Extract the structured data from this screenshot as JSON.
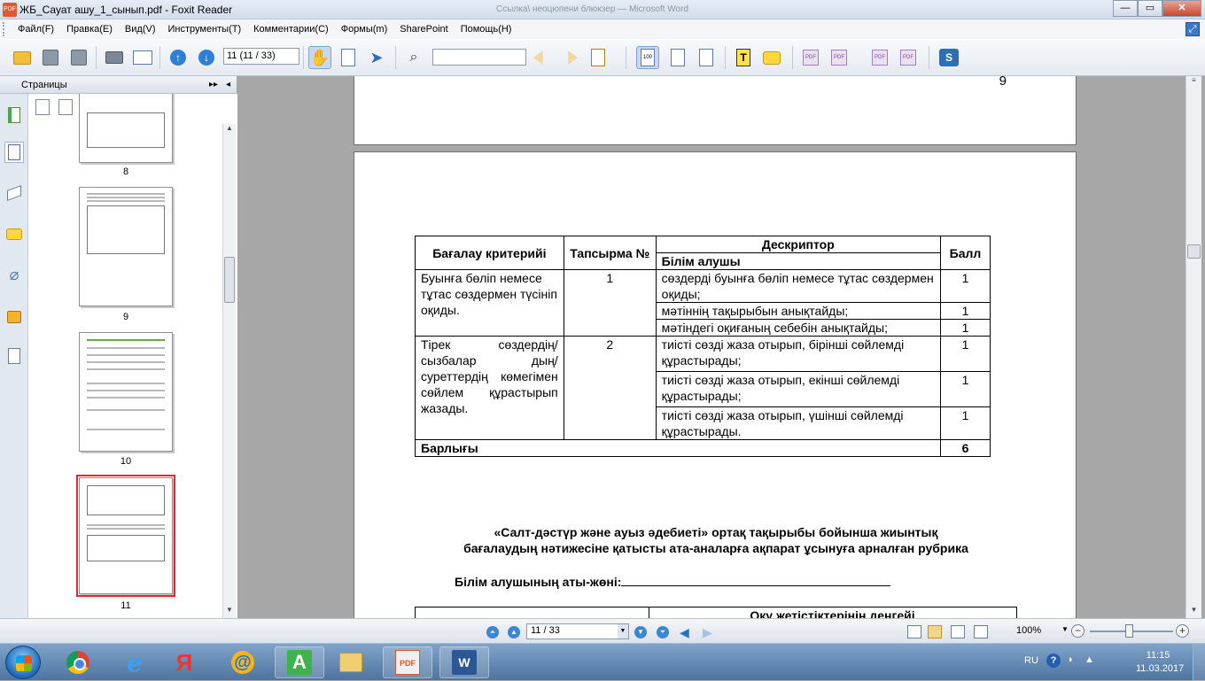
{
  "window": {
    "title": "ЖБ_Сауат ашу_1_сынып.pdf - Foxit Reader",
    "background_title": "Ссылка\\ неоцюпени блюкзер — Microsoft Word",
    "app_icon_text": "PDF",
    "minimize": "—",
    "maximize": "▭",
    "close": "✕"
  },
  "menu": [
    "Файл(F)",
    "Правка(E)",
    "Вид(V)",
    "Инструменты(T)",
    "Комментарии(C)",
    "Формы(m)",
    "SharePoint",
    "Помощь(H)"
  ],
  "toolbar": {
    "page_value": "11 (11 / 33)",
    "search_value": ""
  },
  "pages_panel": {
    "title": "Страницы",
    "expand": "▸▸",
    "collapse": "◂",
    "thumbs": [
      {
        "label": "8"
      },
      {
        "label": "9"
      },
      {
        "label": "10"
      },
      {
        "label": "11"
      }
    ]
  },
  "document": {
    "prev_page_number": "9",
    "table": {
      "headers": {
        "criteria": "Бағалау критерийі",
        "task": "Тапсырма №",
        "descriptor": "Дескриптор",
        "learner": "Білім алушы",
        "score": "Балл"
      },
      "group1": {
        "criterion": "Буынға бөліп немесе тұтас сөздермен түсініп оқиды.",
        "task": "1",
        "rows": [
          {
            "desc": "сөздерді буынға бөліп немесе тұтас сөздермен оқиды;",
            "score": "1"
          },
          {
            "desc": "мәтіннің тақырыбын анықтайды;",
            "score": "1"
          },
          {
            "desc": "мәтіндегі оқиғаның себебін анықтайды;",
            "score": "1"
          }
        ]
      },
      "group2": {
        "criterion": "Тірек сөздердің/сызбалар дың/суреттердің көмегімен сөйлем құрастырып жазады.",
        "task": "2",
        "rows": [
          {
            "desc": "тиісті сөзді жаза отырып, бірінші сөйлемді құрастырады;",
            "score": "1"
          },
          {
            "desc": "тиісті сөзді жаза отырып, екінші сөйлемді құрастырады;",
            "score": "1"
          },
          {
            "desc": "тиісті сөзді жаза отырып, үшінші сөйлемді құрастырады.",
            "score": "1"
          }
        ]
      },
      "total_label": "Барлығы",
      "total_value": "6"
    },
    "heading_line1": "«Салт-дәстүр және ауыз әдебиеті» ортақ тақырыбы бойынша жиынтық",
    "heading_line2": "бағалаудың нәтижесіне қатысты ата-аналарға ақпарат ұсынуға арналған рубрика",
    "name_label": "Білім алушының аты-жөні:",
    "next_table_header": "Оқу жетістіктерінің деңгейі"
  },
  "statusbar": {
    "page_select": "11 / 33",
    "zoom": "100%"
  },
  "taskbar": {
    "lang": "RU",
    "time": "11:15",
    "date": "11.03.2017",
    "pdf_label": "PDF",
    "word_label": "W",
    "a_label": "A",
    "yandex_label": "Я",
    "mail_label": "@"
  },
  "colors": {
    "accent": "#3d86d6",
    "selection": "#e02a2a",
    "pdf_brand": "#e4562e"
  }
}
